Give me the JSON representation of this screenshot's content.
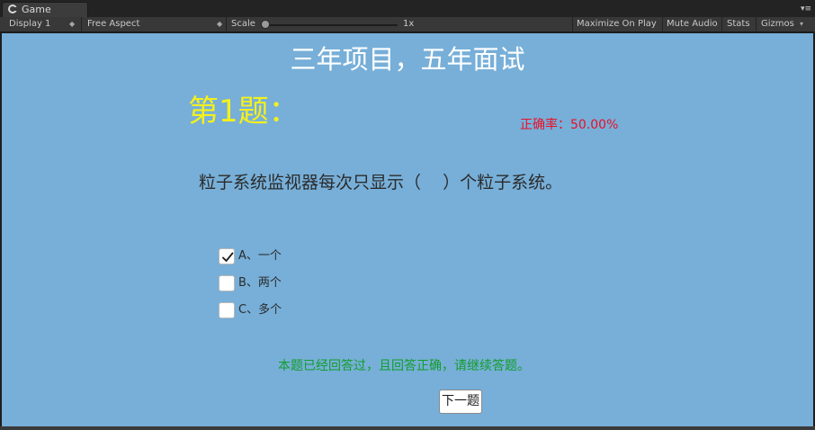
{
  "window": {
    "tab_label": "Game"
  },
  "toolbar": {
    "display": "Display 1",
    "aspect": "Free Aspect",
    "scale_label": "Scale",
    "scale_value": "1x",
    "maximize_on_play": "Maximize On Play",
    "mute_audio": "Mute Audio",
    "stats": "Stats",
    "gizmos": "Gizmos"
  },
  "game": {
    "title": "三年项目，五年面试",
    "question_number": "第1题：",
    "accuracy": "正确率：50.00%",
    "question_text": "粒子系统监视器每次只显示（    ）个粒子系统。",
    "options": [
      {
        "label": "A、一个",
        "checked": true
      },
      {
        "label": "B、两个",
        "checked": false
      },
      {
        "label": "C、多个",
        "checked": false
      }
    ],
    "feedback": "本题已经回答过，且回答正确，请继续答题。",
    "next_button": "下一题"
  },
  "colors": {
    "background": "#77afd8",
    "title": "#ffffff",
    "question_number": "#f4f01c",
    "accuracy": "#e8102a",
    "feedback": "#129d2a"
  },
  "icons": {
    "tab": "unity-game-icon",
    "menu": "tab-menu-icon",
    "check": "checkmark-icon"
  }
}
